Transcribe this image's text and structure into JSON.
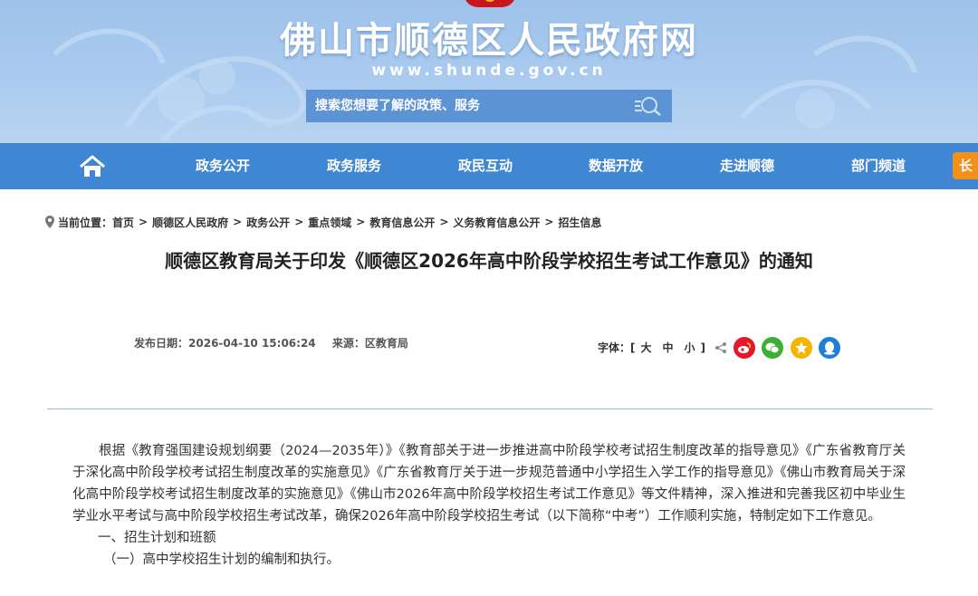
{
  "header": {
    "site_title": "佛山市顺德区人民政府网",
    "site_url": "www.shunde.gov.cn",
    "search_placeholder": "搜索您想要了解的政策、服务",
    "colors": {
      "banner": "#aacbef",
      "search": "#5c93d5",
      "emblem": "#c8161d"
    }
  },
  "nav": {
    "home_icon": "home-icon",
    "items": [
      "政务公开",
      "政务服务",
      "政民互动",
      "数据开放",
      "走进顺德",
      "部门频道"
    ],
    "side_tab": "长",
    "colors": {
      "bar": "#3f86d3",
      "side_tab": "#f39019"
    }
  },
  "breadcrumb": {
    "prefix": "当前位置：",
    "items": [
      "首页",
      "顺德区人民政府",
      "政务公开",
      "重点领域",
      "教育信息公开",
      "义务教育信息公开",
      "招生信息"
    ],
    "separator": ">"
  },
  "article": {
    "title": "顺德区教育局关于印发《顺德区2026年高中阶段学校招生考试工作意见》的通知",
    "publish_label": "发布日期：",
    "publish_date": "2026-04-10 15:06:24",
    "source_label": "来源：",
    "source": "区教育局",
    "font_label": "字体：[",
    "font_large": "大",
    "font_medium": "中",
    "font_small": "小",
    "font_close": "]",
    "share_icons": [
      "weibo-icon",
      "wechat-icon",
      "favorite-star-icon",
      "qq-icon"
    ],
    "share_colors": [
      "#e6162d",
      "#3cb034",
      "#f4b400",
      "#1e7fd8"
    ],
    "paragraphs": [
      "根据《教育强国建设规划纲要（2024—2035年）》《教育部关于进一步推进高中阶段学校考试招生制度改革的指导意见》《广东省教育厅关于深化高中阶段学校考试招生制度改革的实施意见》《广东省教育厅关于进一步规范普通中小学招生入学工作的指导意见》《佛山市教育局关于深化高中阶段学校考试招生制度改革的实施意见》《佛山市2026年高中阶段学校招生考试工作意见》等文件精神，深入推进和完善我区初中毕业生学业水平考试与高中阶段学校招生考试改革，确保2026年高中阶段学校招生考试（以下简称“中考”）工作顺利实施，特制定如下工作意见。"
    ],
    "heading1": "一、招生计划和班额",
    "heading2": "（一）高中学校招生计划的编制和执行。"
  }
}
